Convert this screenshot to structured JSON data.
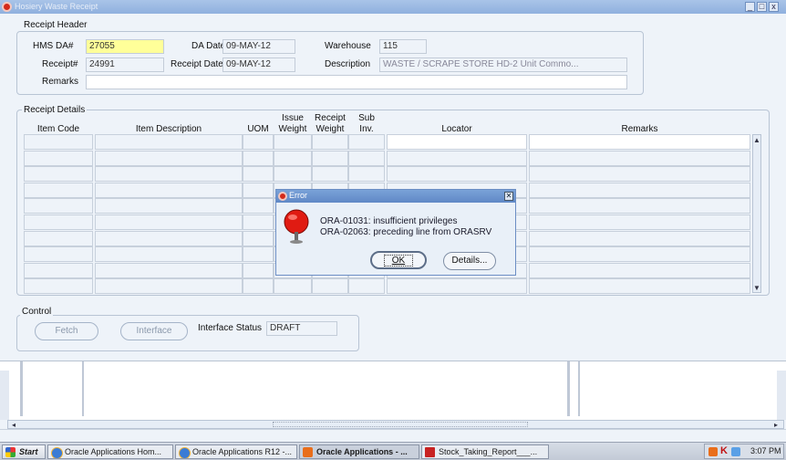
{
  "window": {
    "title": "Hosiery Waste Receipt",
    "min": "_",
    "max": "□",
    "close": "x"
  },
  "header": {
    "group_label": "Receipt Header",
    "hms_label": "HMS DA#",
    "hms_value": "27055",
    "da_date_label": "DA Date",
    "da_date_value": "09-MAY-12",
    "warehouse_label": "Warehouse",
    "warehouse_value": "115",
    "receipt_label": "Receipt#",
    "receipt_value": "24991",
    "receipt_date_label": "Receipt Date",
    "receipt_date_value": "09-MAY-12",
    "description_label": "Description",
    "description_value": "WASTE / SCRAPE STORE HD-2 Unit Commo...",
    "remarks_label": "Remarks",
    "remarks_value": ""
  },
  "details": {
    "group_label": "Receipt Details",
    "columns": [
      "Item Code",
      "Item Description",
      "UOM",
      "Issue Weight",
      "Receipt Weight",
      "Sub Inv.",
      "Locator",
      "Remarks"
    ],
    "col_issue_1": "Issue",
    "col_issue_2": "Weight",
    "col_receipt_1": "Receipt",
    "col_receipt_2": "Weight",
    "col_sub_1": "Sub",
    "col_sub_2": "Inv."
  },
  "control": {
    "group_label": "Control",
    "fetch_label": "Fetch",
    "interface_label": "Interface",
    "status_label": "Interface Status",
    "status_value": "DRAFT"
  },
  "dialog": {
    "title": "Error",
    "line1": "ORA-01031: insufficient privileges",
    "line2": "ORA-02063: preceding line from ORASRV",
    "ok_label": "OK",
    "details_label": "Details..."
  },
  "taskbar": {
    "start": "Start",
    "items": [
      "Oracle Applications Hom...",
      "Oracle Applications R12 -...",
      "Oracle Applications - ...",
      "Stock_Taking_Report___..."
    ],
    "clock": "3:07 PM"
  }
}
